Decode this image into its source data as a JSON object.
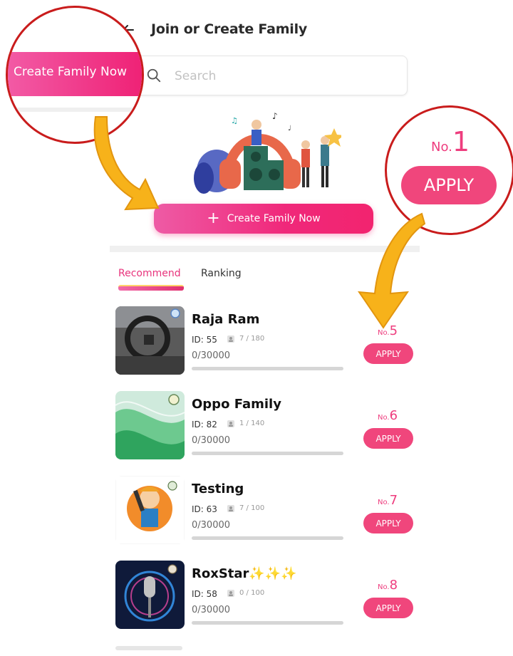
{
  "header": {
    "title": "Join or Create Family"
  },
  "search": {
    "placeholder": "Search",
    "value": ""
  },
  "create_button": {
    "label": "Create Family Now"
  },
  "tabs": [
    {
      "label": "Recommend",
      "active": true
    },
    {
      "label": "Ranking",
      "active": false
    }
  ],
  "families": [
    {
      "name": "Raja Ram",
      "id_text": "ID: 55",
      "members": "7 / 180",
      "points": "0/30000",
      "progress": 0,
      "rank_prefix": "No.",
      "rank": "5",
      "apply_label": "APPLY"
    },
    {
      "name": "Oppo Family",
      "id_text": "ID: 82",
      "members": "1 / 140",
      "points": "0/30000",
      "progress": 0,
      "rank_prefix": "No.",
      "rank": "6",
      "apply_label": "APPLY"
    },
    {
      "name": "Testing",
      "id_text": "ID: 63",
      "members": "7 / 100",
      "points": "0/30000",
      "progress": 0,
      "rank_prefix": "No.",
      "rank": "7",
      "apply_label": "APPLY"
    },
    {
      "name": "RoxStar✨✨✨",
      "id_text": "ID: 58",
      "members": "0 / 100",
      "points": "0/30000",
      "progress": 0,
      "rank_prefix": "No.",
      "rank": "8",
      "apply_label": "APPLY"
    }
  ],
  "callouts": {
    "left_zoom_label": "Create Family Now",
    "right_rank_prefix": "No.",
    "right_rank": "1",
    "right_apply_label": "APPLY"
  },
  "colors": {
    "accent": "#f0467c",
    "callout_ring": "#c91c1c",
    "arrow": "#f7b21a"
  },
  "icons": [
    "back-arrow-icon",
    "search-icon",
    "plus-icon",
    "member-icon",
    "music-party-illustration",
    "family-badge-icon"
  ]
}
